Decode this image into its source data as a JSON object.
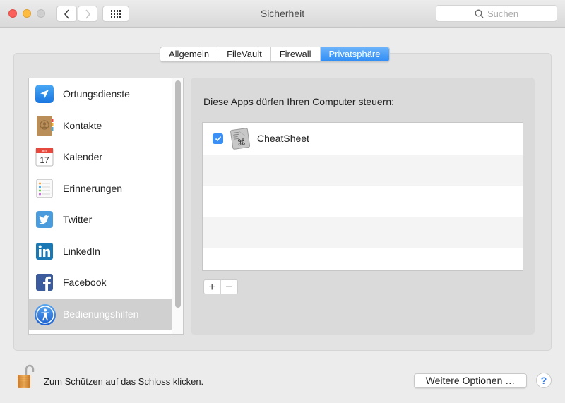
{
  "window": {
    "title": "Sicherheit",
    "search_placeholder": "Suchen"
  },
  "tabs": [
    {
      "label": "Allgemein",
      "active": false
    },
    {
      "label": "FileVault",
      "active": false
    },
    {
      "label": "Firewall",
      "active": false
    },
    {
      "label": "Privatsphäre",
      "active": true
    }
  ],
  "sidebar": {
    "items": [
      {
        "label": "Ortungsdienste",
        "icon": "location-arrow-icon",
        "selected": false
      },
      {
        "label": "Kontakte",
        "icon": "contacts-book-icon",
        "selected": false
      },
      {
        "label": "Kalender",
        "icon": "calendar-icon",
        "selected": false,
        "calendar_month": "JUL",
        "calendar_day": "17"
      },
      {
        "label": "Erinnerungen",
        "icon": "reminders-icon",
        "selected": false
      },
      {
        "label": "Twitter",
        "icon": "twitter-icon",
        "selected": false
      },
      {
        "label": "LinkedIn",
        "icon": "linkedin-icon",
        "selected": false
      },
      {
        "label": "Facebook",
        "icon": "facebook-icon",
        "selected": false
      },
      {
        "label": "Bedienungshilfen",
        "icon": "accessibility-icon",
        "selected": true
      }
    ]
  },
  "content": {
    "heading": "Diese Apps dürfen Ihren Computer steuern:",
    "apps": [
      {
        "name": "CheatSheet",
        "checked": true,
        "icon": "cheatsheet-app-icon"
      }
    ],
    "add_label": "+",
    "remove_label": "−"
  },
  "footer": {
    "lock_text": "Zum Schützen auf das Schloss klicken.",
    "more_options_label": "Weitere Optionen …",
    "help_label": "?"
  },
  "colors": {
    "accent": "#2f8cf5",
    "selected_row": "#d0d0d0"
  }
}
